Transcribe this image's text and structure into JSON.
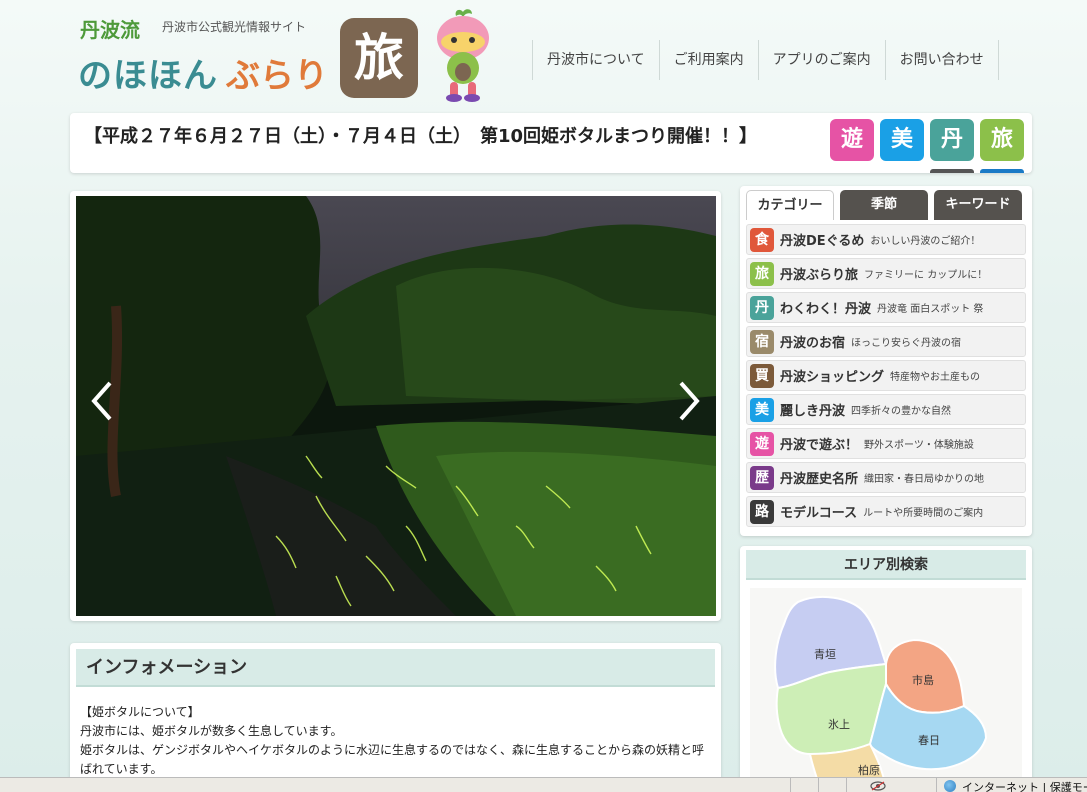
{
  "header": {
    "logo_small": "丹波流",
    "logo_sub": "丹波市公式観光情報サイト",
    "logo_main1": "のほほん",
    "logo_main2": "ぶらり",
    "logo_tabi": "旅"
  },
  "nav": {
    "items": [
      "丹波市について",
      "ご利用案内",
      "アプリのご案内",
      "お問い合わせ"
    ]
  },
  "banner": {
    "title": "【平成２７年６月２７日（土）・７月４日（土）　第10回姫ボタルまつり開催！！】",
    "badges": [
      {
        "label": "遊",
        "color": "#e653a5"
      },
      {
        "label": "美",
        "color": "#1aa0e6"
      },
      {
        "label": "丹",
        "color": "#4aa39a"
      },
      {
        "label": "旅",
        "color": "#8cc04a"
      }
    ]
  },
  "slider": {
    "prev_label": "prev",
    "next_label": "next"
  },
  "info": {
    "heading": "インフォメーション",
    "lines": [
      "【姫ボタルについて】",
      "丹波市には、姫ボタルが数多く生息しています。",
      "姫ボタルは、ゲンジボタルやヘイケボタルのように水辺に生息するのではなく、森に生息することから森の妖精と呼",
      "ばれています。"
    ]
  },
  "sidebar": {
    "tabs": [
      "カテゴリー",
      "季節",
      "キーワード"
    ],
    "categories": [
      {
        "icon": "食",
        "color": "#e0573a",
        "name": "丹波DEぐるめ",
        "desc": "おいしい丹波のご紹介！"
      },
      {
        "icon": "旅",
        "color": "#8cc04a",
        "name": "丹波ぶらり旅",
        "desc": "ファミリーに カップルに！"
      },
      {
        "icon": "丹",
        "color": "#4aa39a",
        "name": "わくわく！丹波",
        "desc": "丹波竜 面白スポット 祭"
      },
      {
        "icon": "宿",
        "color": "#9a8a6a",
        "name": "丹波のお宿",
        "desc": "ほっこり安らぐ丹波の宿"
      },
      {
        "icon": "買",
        "color": "#7c5a3a",
        "name": "丹波ショッピング",
        "desc": "特産物やお土産もの"
      },
      {
        "icon": "美",
        "color": "#1aa0e6",
        "name": "麗しき丹波",
        "desc": "四季折々の豊かな自然"
      },
      {
        "icon": "遊",
        "color": "#e653a5",
        "name": "丹波で遊ぶ！",
        "desc": "野外スポーツ・体験施設"
      },
      {
        "icon": "歴",
        "color": "#7a3a8a",
        "name": "丹波歴史名所",
        "desc": "織田家・春日局ゆかりの地"
      },
      {
        "icon": "路",
        "color": "#3a3a3a",
        "name": "モデルコース",
        "desc": "ルートや所要時間のご案内"
      }
    ]
  },
  "area": {
    "heading": "エリア別検索",
    "regions": [
      {
        "name": "青垣",
        "color": "#c6cdf2"
      },
      {
        "name": "市島",
        "color": "#f3a584"
      },
      {
        "name": "氷上",
        "color": "#cdeeb6"
      },
      {
        "name": "春日",
        "color": "#a6d8f2"
      },
      {
        "name": "柏原",
        "color": "#f4dca6"
      }
    ]
  },
  "statusbar": {
    "zone_text": "インターネット | 保護モード"
  }
}
